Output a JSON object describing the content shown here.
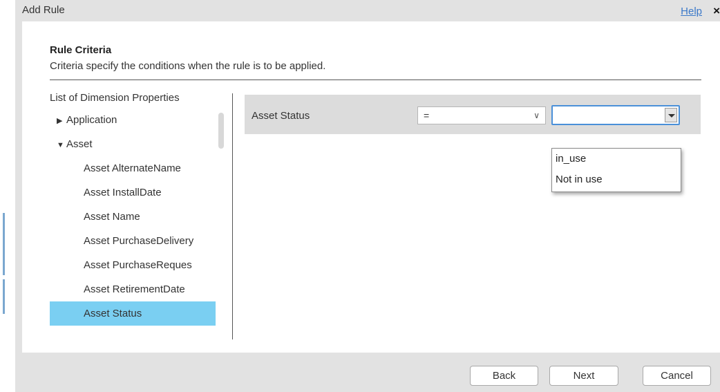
{
  "dialog": {
    "title": "Add Rule",
    "help_label": "Help",
    "close_glyph": "×"
  },
  "section": {
    "title": "Rule Criteria",
    "description": "Criteria specify the conditions when the rule is to be applied."
  },
  "dimension_list": {
    "header": "List of Dimension Properties",
    "items": [
      {
        "label": "Application",
        "level": 0,
        "caret": "▶",
        "state": "collapsed"
      },
      {
        "label": "Asset",
        "level": 0,
        "caret": "▼",
        "state": "expanded"
      },
      {
        "label": "Asset AlternateName",
        "level": 1
      },
      {
        "label": "Asset InstallDate",
        "level": 1
      },
      {
        "label": "Asset Name",
        "level": 1
      },
      {
        "label": "Asset PurchaseDelivery",
        "level": 1
      },
      {
        "label": "Asset PurchaseReques",
        "level": 1
      },
      {
        "label": "Asset RetirementDate",
        "level": 1
      },
      {
        "label": "Asset Status",
        "level": 1,
        "selected": true
      }
    ]
  },
  "criteria": {
    "property_label": "Asset Status",
    "operator_value": "=",
    "value_input": "",
    "value_options": [
      "in_use",
      "Not in use"
    ]
  },
  "footer": {
    "back_label": "Back",
    "next_label": "Next",
    "cancel_label": "Cancel"
  },
  "colors": {
    "selected_item": "#7acff2",
    "link": "#3a78c9",
    "focus_border": "#4a90d9"
  }
}
